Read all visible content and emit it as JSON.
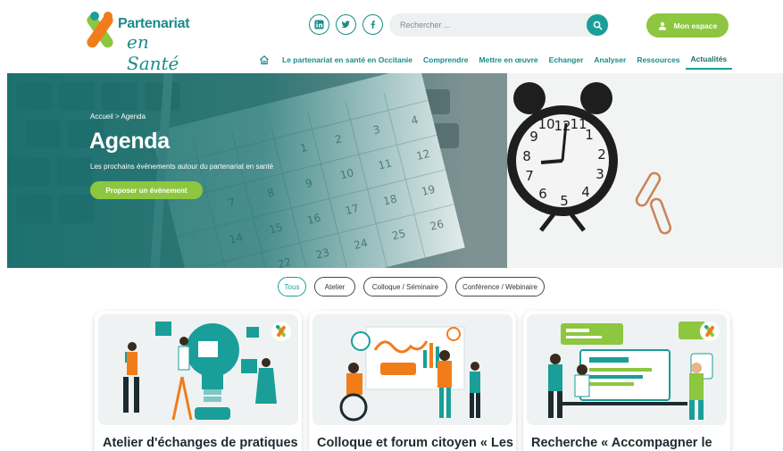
{
  "header": {
    "logo": {
      "line1": "Partenariat",
      "line2": "en Santé"
    },
    "social": [
      {
        "name": "linkedin-icon",
        "glyph": "in"
      },
      {
        "name": "twitter-icon",
        "glyph": "t"
      },
      {
        "name": "facebook-icon",
        "glyph": "f"
      }
    ],
    "search": {
      "placeholder": "Rechercher ..."
    },
    "account_label": "Mon espace",
    "nav": [
      "Le partenariat en santé en Occitanie",
      "Comprendre",
      "Mettre en œuvre",
      "Echanger",
      "Analyser",
      "Ressources",
      "Actualités"
    ],
    "nav_active_index": 6
  },
  "hero": {
    "breadcrumb": "Accueil > Agenda",
    "title": "Agenda",
    "subtitle": "Les prochains événements autour du partenariat en santé",
    "cta": "Proposer un événement"
  },
  "filters": {
    "items": [
      "Tous",
      "Atelier",
      "Colloque / Séminaire",
      "Conférence / Webinaire"
    ],
    "active_index": 0
  },
  "cards": [
    {
      "title": "Atelier d'échanges de pratiques",
      "image": "puzzle-lightbulb-illustration"
    },
    {
      "title": "Colloque et forum citoyen « Les",
      "image": "presentation-board-illustration"
    },
    {
      "title": "Recherche « Accompagner le",
      "image": "computer-screens-illustration"
    }
  ],
  "colors": {
    "teal": "#1a9e99",
    "green": "#8dc63f",
    "orange": "#f07d1a",
    "dark": "#1d2a2e"
  }
}
